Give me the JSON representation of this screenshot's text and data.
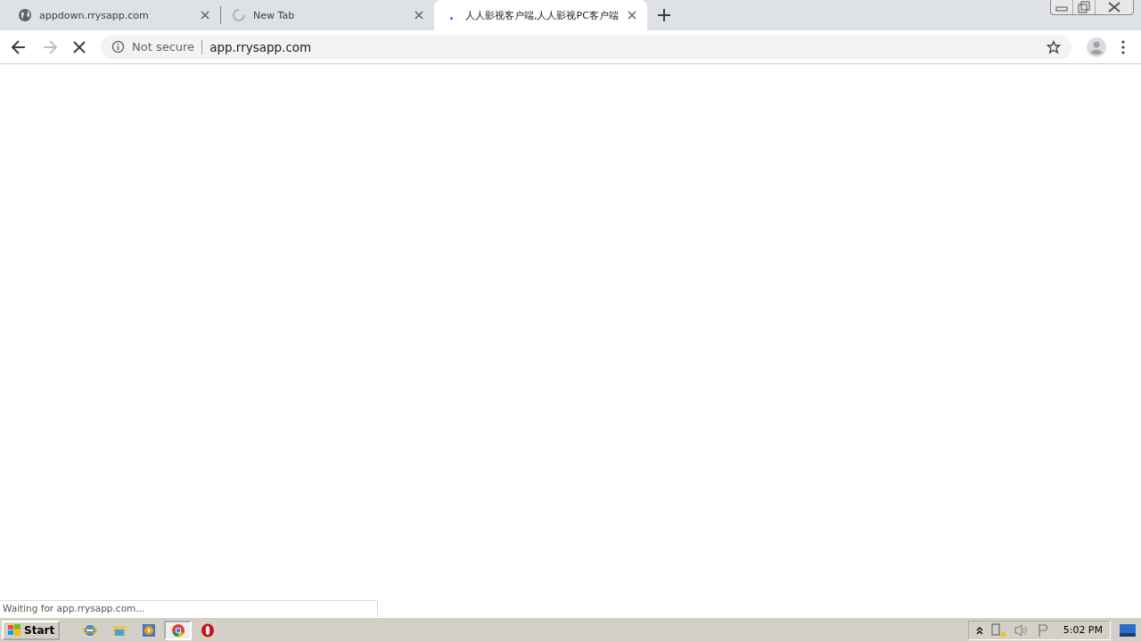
{
  "tabs": [
    {
      "title": "appdown.rrysapp.com",
      "kind": "globe",
      "selected": false
    },
    {
      "title": "New Tab",
      "kind": "spinner",
      "selected": false
    },
    {
      "title": "人人影视客户端,人人影视PC客户端",
      "kind": "dot",
      "selected": true
    }
  ],
  "address_bar": {
    "security": "Not secure",
    "url": "app.rrysapp.com"
  },
  "status": "Waiting for app.rrysapp.com...",
  "taskbar": {
    "start": "Start",
    "apps": [
      {
        "kind": "ie",
        "selected": false
      },
      {
        "kind": "explorer",
        "selected": false
      },
      {
        "kind": "media",
        "selected": false
      },
      {
        "kind": "chrome",
        "selected": true
      },
      {
        "kind": "opera",
        "selected": false
      }
    ],
    "clock": "5:02 PM"
  }
}
